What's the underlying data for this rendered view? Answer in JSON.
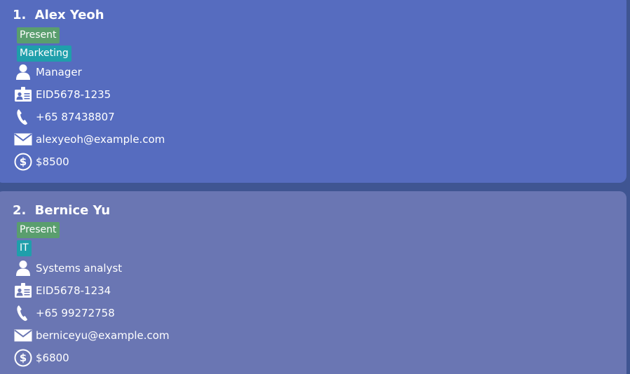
{
  "employees": [
    {
      "index": "1.",
      "name": "Alex Yeoh",
      "status": "Present",
      "department": "Marketing",
      "role": "Manager",
      "eid": "EID5678-1235",
      "phone": "+65 87438807",
      "email": "alexyeoh@example.com",
      "salary": "$8500"
    },
    {
      "index": "2.",
      "name": "Bernice Yu",
      "status": "Present",
      "department": "IT",
      "role": "Systems analyst",
      "eid": "EID5678-1234",
      "phone": "+65 99272758",
      "email": "berniceyu@example.com",
      "salary": "$6800"
    }
  ],
  "icons": {
    "role": "person-icon",
    "eid": "id-card-icon",
    "phone": "phone-icon",
    "email": "envelope-icon",
    "salary": "dollar-coin-icon"
  },
  "colors": {
    "background": "#3f5592",
    "card_selected": "#566cbf",
    "card_default": "#6a76b3",
    "tag_status": "#5a9e6e",
    "tag_department": "#1f9fab",
    "text": "#ffffff"
  }
}
